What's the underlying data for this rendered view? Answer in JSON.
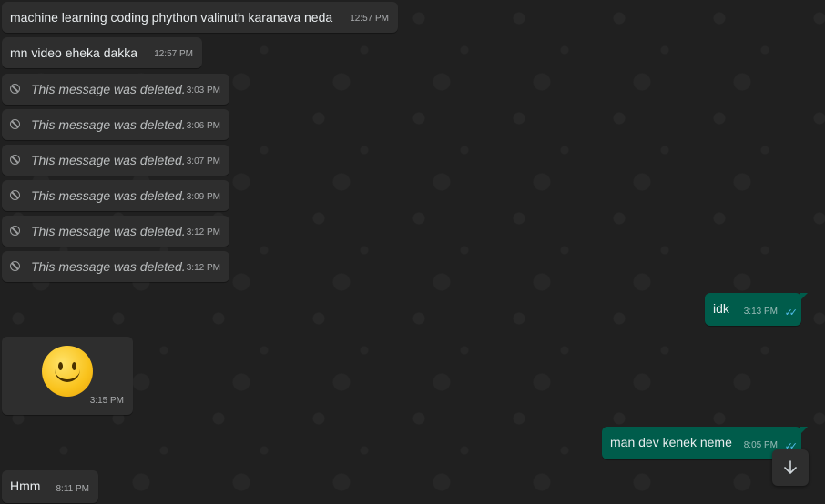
{
  "messages": [
    {
      "text": "machine learning coding phython valinuth karanava neda",
      "time": "12:57 PM"
    },
    {
      "text": "mn video eheka dakka",
      "time": "12:57 PM"
    },
    {
      "text": "This message was deleted.",
      "time": "3:03 PM"
    },
    {
      "text": "This message was deleted.",
      "time": "3:06 PM"
    },
    {
      "text": "This message was deleted.",
      "time": "3:07 PM"
    },
    {
      "text": "This message was deleted.",
      "time": "3:09 PM"
    },
    {
      "text": "This message was deleted.",
      "time": "3:12 PM"
    },
    {
      "text": "This message was deleted.",
      "time": "3:12 PM"
    },
    {
      "text": "idk",
      "time": "3:13 PM"
    },
    {
      "emoji": "slightly-smiling-face",
      "time": "3:15 PM"
    },
    {
      "text": "man dev kenek neme",
      "time": "8:05 PM"
    },
    {
      "text": "Hmm",
      "time": "8:11 PM"
    }
  ],
  "colors": {
    "incoming": "#2e2e2e",
    "outgoing": "#005c4b",
    "background": "#202020",
    "read_ticks": "#53bdeb"
  },
  "icons": {
    "deleted": "ban-icon",
    "read": "double-check-icon",
    "scroll": "arrow-down-icon"
  }
}
